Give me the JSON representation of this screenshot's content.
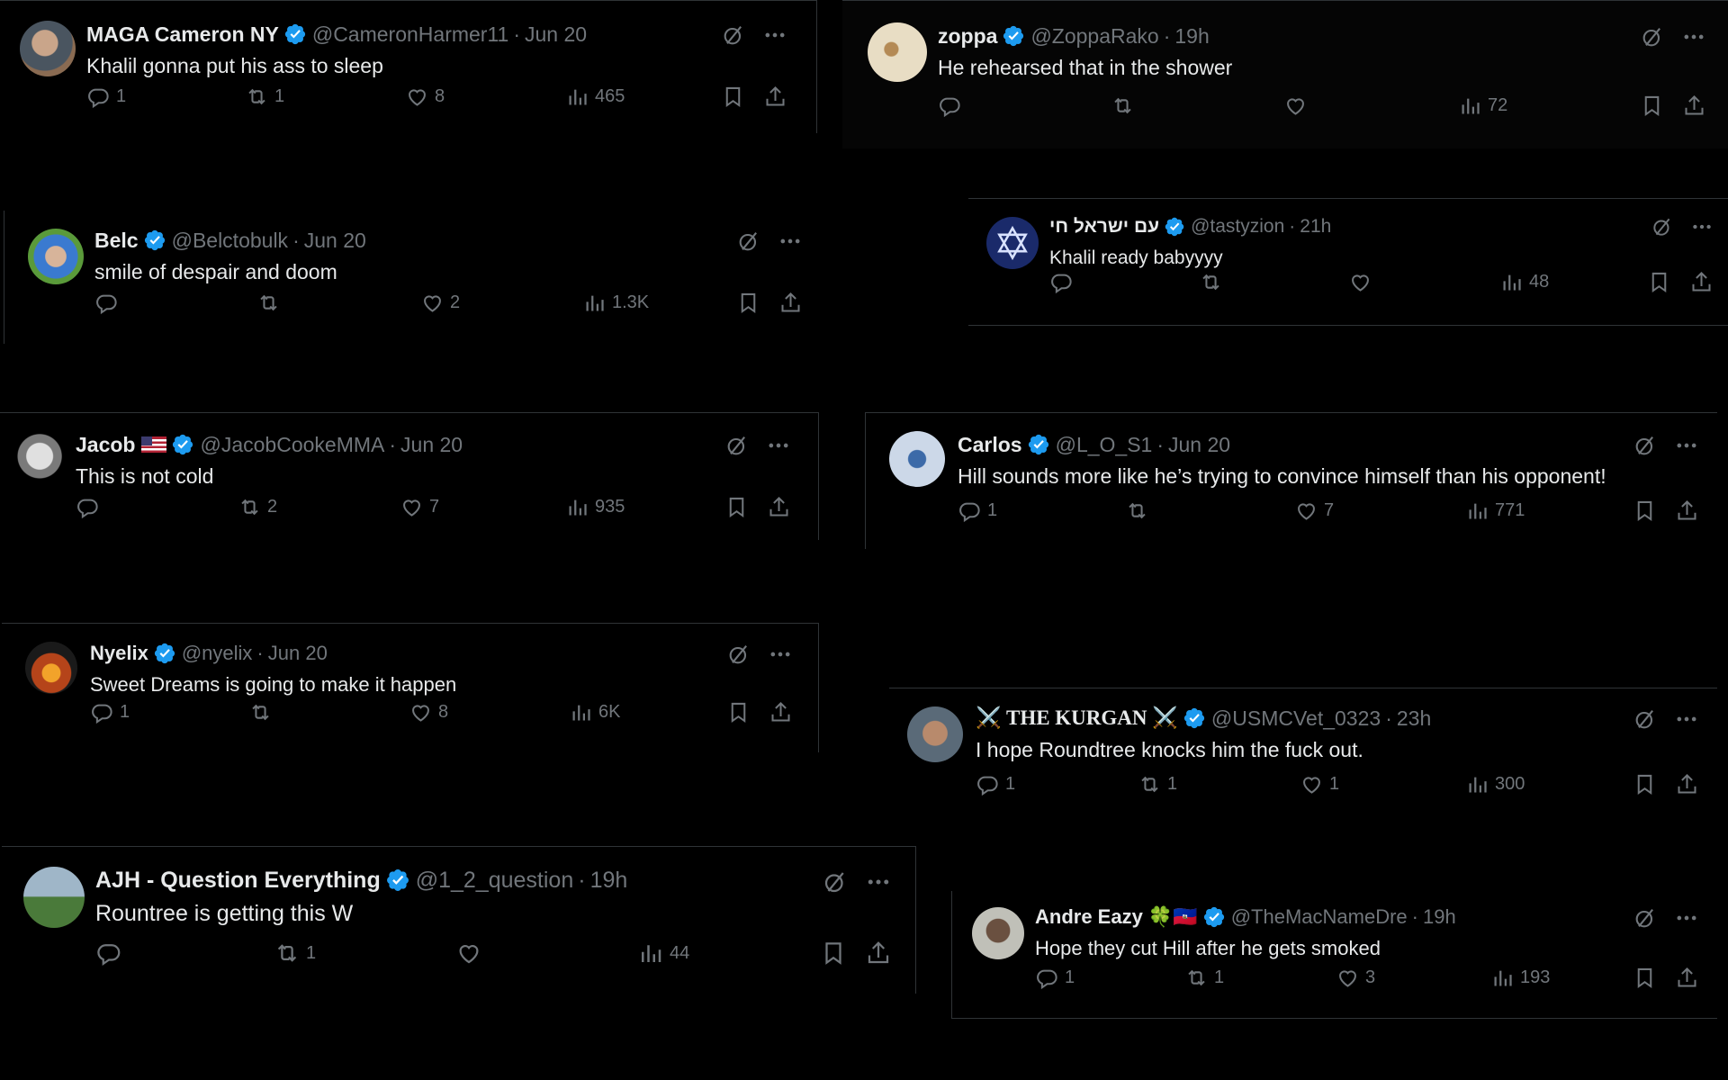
{
  "colors": {
    "background": "#000000",
    "text": "#e7e9ea",
    "muted": "#71767b",
    "verified": "#1d9bf0",
    "border": "#2f3336"
  },
  "tweets": [
    {
      "name": "MAGA Cameron NY",
      "handle": "@CameronHarmer11",
      "time": "Jun 20",
      "text": "Khalil gonna put his ass to sleep",
      "replies": "1",
      "retweets": "1",
      "likes": "8",
      "views": "465"
    },
    {
      "name": "zoppa",
      "handle": "@ZoppaRako",
      "time": "19h",
      "text": "He rehearsed that in the shower",
      "replies": "",
      "retweets": "",
      "likes": "",
      "views": "72"
    },
    {
      "name": "Belc",
      "handle": "@Belctobulk",
      "time": "Jun 20",
      "text": "smile of despair and doom",
      "replies": "",
      "retweets": "",
      "likes": "2",
      "views": "1.3K"
    },
    {
      "name": "עם ישראל חי",
      "handle": "@tastyzion",
      "time": "21h",
      "text": "Khalil ready babyyyy",
      "replies": "",
      "retweets": "",
      "likes": "",
      "views": "48"
    },
    {
      "name": "Jacob",
      "handle": "@JacobCookeMMA",
      "time": "Jun 20",
      "text": "This is not cold",
      "replies": "",
      "retweets": "2",
      "likes": "7",
      "views": "935"
    },
    {
      "name": "Carlos",
      "handle": "@L_O_S1",
      "time": "Jun 20",
      "text": "Hill sounds more like he’s trying to convince himself than his opponent!",
      "replies": "1",
      "retweets": "",
      "likes": "7",
      "views": "771"
    },
    {
      "name": "Nyelix",
      "handle": "@nyelix",
      "time": "Jun 20",
      "text": "Sweet Dreams is going to make it happen",
      "replies": "1",
      "retweets": "",
      "likes": "8",
      "views": "6K"
    },
    {
      "name": "⚔️ THE KURGAN ⚔️",
      "handle": "@USMCVet_0323",
      "time": "23h",
      "text": "I hope Roundtree knocks him the fuck out.",
      "replies": "1",
      "retweets": "1",
      "likes": "1",
      "views": "300"
    },
    {
      "name": "AJH - Question Everything",
      "handle": "@1_2_question",
      "time": "19h",
      "text": "Rountree is getting this W",
      "replies": "",
      "retweets": "1",
      "likes": "",
      "views": "44"
    },
    {
      "name": "Andre Eazy 🍀🇭🇹",
      "handle": "@TheMacNameDre",
      "time": "19h",
      "text": "Hope they cut Hill after he gets smoked",
      "replies": "1",
      "retweets": "1",
      "likes": "3",
      "views": "193"
    }
  ],
  "separator": "·"
}
